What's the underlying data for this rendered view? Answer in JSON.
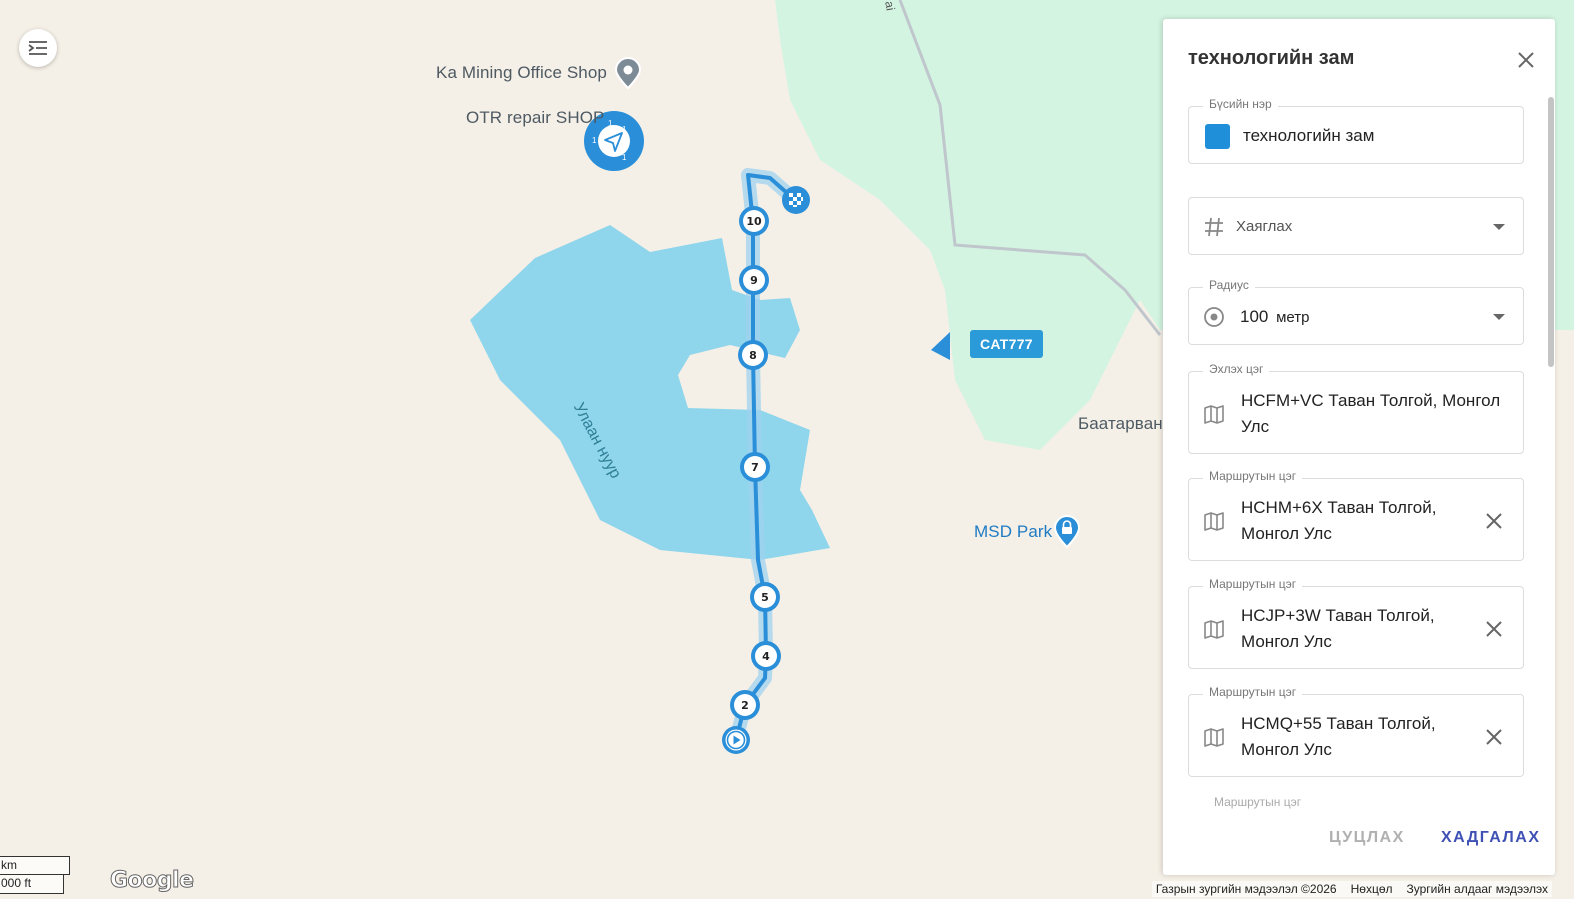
{
  "map": {
    "pois": [
      {
        "label": "Ka Mining Office Shop",
        "icon": "place-pin-icon"
      },
      {
        "label": "OTR repair SHOP",
        "icon": "place-pin-icon"
      },
      {
        "label": "MSD Park",
        "icon": "parking-pin-icon"
      },
      {
        "label": "Баатарван",
        "icon": ""
      }
    ],
    "lake_label": "Улаан нуур",
    "road_label": "ai",
    "vehicle": {
      "label": "CAT777"
    },
    "route_markers": [
      "10",
      "9",
      "8",
      "7",
      "5",
      "4",
      "2"
    ],
    "cluster_digits": [
      "1",
      "1",
      "1",
      "1"
    ],
    "scale": {
      "metric": "km",
      "imperial": "000 ft"
    },
    "google_logo": "Google",
    "attribution": [
      "Газрын зургийн мэдээлэл ©2026",
      "Нөхцөл",
      "Зургийн алдааг мэдээлэх"
    ],
    "colors": {
      "route": "#2a8fd8",
      "lake": "#8fd6ec",
      "green": "#d4f4e2",
      "land": "#f5f0e7"
    }
  },
  "panel": {
    "title": "технологийн зам",
    "zone_name": {
      "label": "Бүсийн нэр",
      "value": "технологийн зам",
      "color": "#1e8fd8"
    },
    "attach": {
      "placeholder": "Хаяглах",
      "icon": "hash-icon"
    },
    "radius": {
      "label": "Радиус",
      "value": "100",
      "unit": "метр"
    },
    "start": {
      "label": "Эхлэх цэг",
      "value": "HCFM+VC Таван Толгой, Монгол Улс"
    },
    "waypoints": [
      {
        "label": "Маршрутын цэг",
        "value": "HCHM+6X Таван Толгой, Монгол Улс"
      },
      {
        "label": "Маршрутын цэг",
        "value": "HCJP+3W Таван Толгой, Монгол Улс"
      },
      {
        "label": "Маршрутын цэг",
        "value": "HCMQ+55 Таван Толгой, Монгол Улс"
      }
    ],
    "next_label": "Маршрутын цэг",
    "cancel_label": "ЦУЦЛАХ",
    "save_label": "ХАДГАЛАХ"
  }
}
